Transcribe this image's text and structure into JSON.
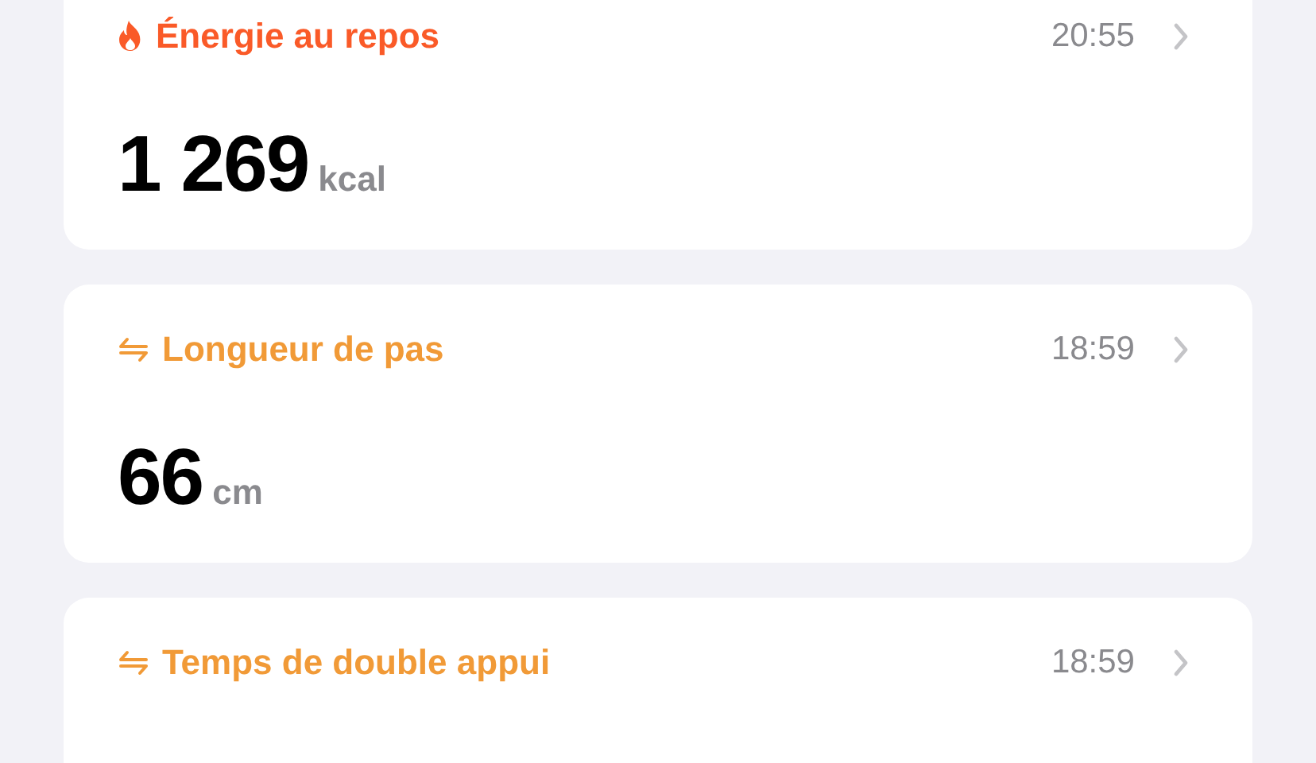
{
  "cards": [
    {
      "kind": "flame",
      "color": "#fa5a28",
      "title": "Énergie au repos",
      "time": "20:55",
      "value": "1 269",
      "unit": "kcal"
    },
    {
      "kind": "arrows",
      "color": "#f19a37",
      "title": "Longueur de pas",
      "time": "18:59",
      "value": "66",
      "unit": "cm"
    },
    {
      "kind": "arrows",
      "color": "#f19a37",
      "title": "Temps de double appui",
      "time": "18:59"
    }
  ]
}
